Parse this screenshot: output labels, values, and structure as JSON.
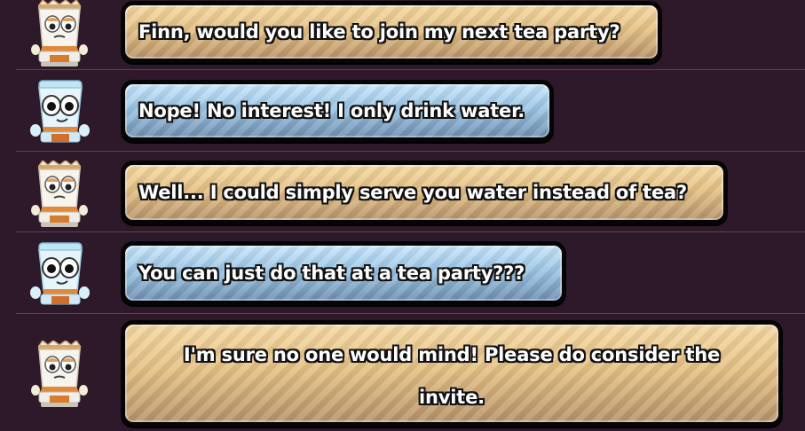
{
  "messages": [
    {
      "speaker": "teacup",
      "color": "orange",
      "text": "Finn, would you like to join my next tea party?"
    },
    {
      "speaker": "water-cup",
      "color": "blue",
      "text": "Nope! No interest! I only drink water."
    },
    {
      "speaker": "teacup",
      "color": "orange",
      "text": "Well... I could simply serve you water instead of tea?"
    },
    {
      "speaker": "water-cup",
      "color": "blue",
      "text": "You can just do that at a tea party???"
    },
    {
      "speaker": "teacup",
      "color": "orange",
      "text": "I'm sure no one would mind! Please do consider the invite."
    }
  ],
  "colors": {
    "background": "#2d1929",
    "divider": "#5a4453",
    "bubble_orange": "#e6c286",
    "bubble_blue": "#9dc6e6",
    "bubble_border": "#050505"
  }
}
